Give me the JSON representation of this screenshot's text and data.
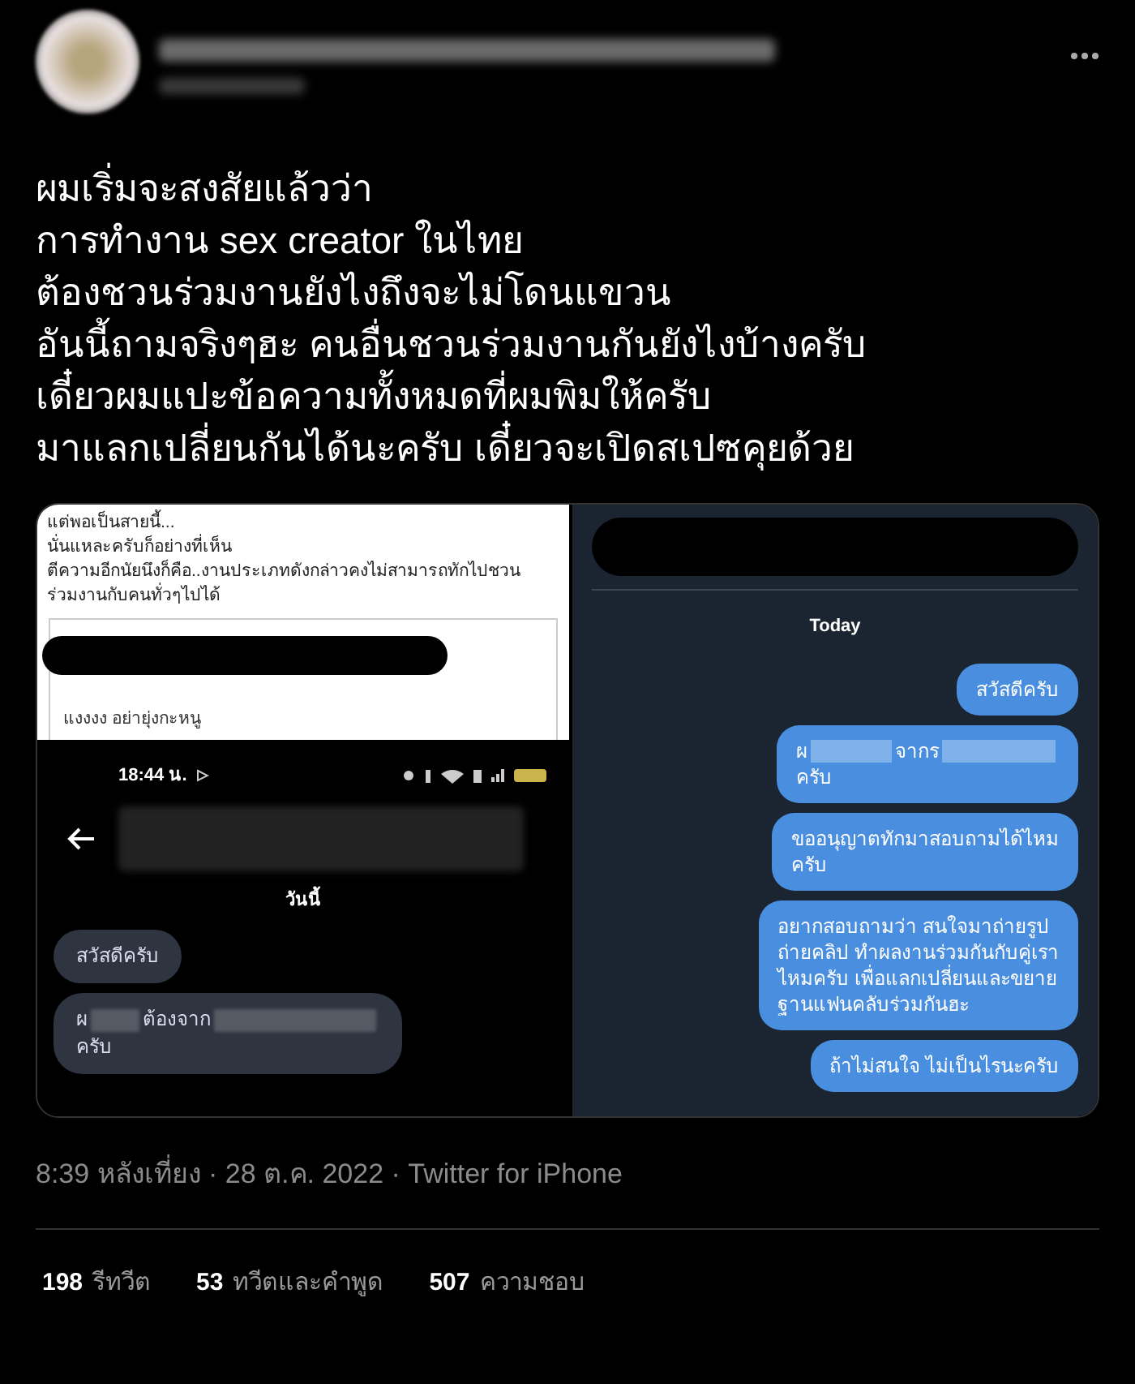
{
  "tweet": {
    "lines": [
      "ผมเริ่มจะสงสัยแล้วว่า",
      "การทำงาน sex creator ในไทย",
      "ต้องชวนร่วมงานยังไงถึงจะไม่โดนแขวน",
      "อันนี้ถามจริงๆฮะ คนอื่นชวนร่วมงานกันยังไงบ้างครับ",
      "เดี๋ยวผมแปะข้อความทั้งหมดที่ผมพิมให้ครับ",
      "มาแลกเปลี่ยนกันได้นะครับ เดี๋ยวจะเปิดสเปซคุยด้วย"
    ]
  },
  "media": {
    "left_top": {
      "lines": [
        "แต่พอเป็นสายนี้...",
        "นั่นแหละครับก็อย่างที่เห็น",
        "ตีความอีกนัยนึงก็คือ..งานประเภทดังกล่าวคงไม่สามารถทักไปชวน",
        "ร่วมงานกับคนทั่วๆไปได้"
      ],
      "quote": "แงงงง อย่ายุ่งกะหนู"
    },
    "left_bottom": {
      "time": "18:44 น.",
      "day": "วันนี้",
      "messages": [
        {
          "lines": [
            [
              {
                "kind": "text",
                "text": "สวัสดีครับ"
              }
            ]
          ]
        },
        {
          "lines": [
            [
              {
                "kind": "text",
                "text": "ผ"
              },
              {
                "kind": "blur"
              },
              {
                "kind": "text",
                "text": "ต้องจาก"
              },
              {
                "kind": "blur"
              }
            ],
            [
              {
                "kind": "text",
                "text": "ครับ"
              }
            ]
          ]
        }
      ]
    },
    "right": {
      "day": "Today",
      "messages": [
        {
          "lines": [
            [
              {
                "kind": "text",
                "text": "สวัสดีครับ"
              }
            ]
          ]
        },
        {
          "lines": [
            [
              {
                "kind": "text",
                "text": "ผ"
              },
              {
                "kind": "blur"
              },
              {
                "kind": "text",
                "text": "จากร"
              },
              {
                "kind": "blur"
              }
            ],
            [
              {
                "kind": "text",
                "text": "ครับ"
              }
            ]
          ]
        },
        {
          "lines": [
            [
              {
                "kind": "text",
                "text": "ขออนุญาตทักมาสอบถามได้ไหม"
              }
            ],
            [
              {
                "kind": "text",
                "text": "ครับ"
              }
            ]
          ]
        },
        {
          "lines": [
            [
              {
                "kind": "text",
                "text": "อยากสอบถามว่า สนใจมาถ่ายรูป"
              }
            ],
            [
              {
                "kind": "text",
                "text": "ถ่ายคลิป ทำผลงานร่วมกันกับคู่เรา"
              }
            ],
            [
              {
                "kind": "text",
                "text": "ไหมครับ เพื่อแลกเปลี่ยนและขยาย"
              }
            ],
            [
              {
                "kind": "text",
                "text": "ฐานแฟนคลับร่วมกันฮะ"
              }
            ]
          ]
        },
        {
          "lines": [
            [
              {
                "kind": "text",
                "text": "ถ้าไม่สนใจ ไม่เป็นไรนะครับ"
              }
            ]
          ]
        }
      ]
    }
  },
  "meta": "8:39 หลังเที่ยง · 28 ต.ค. 2022 · Twitter for iPhone",
  "stats": [
    {
      "count": "198",
      "label": "รีทวีต"
    },
    {
      "count": "53",
      "label": "ทวีตและคำพูด"
    },
    {
      "count": "507",
      "label": "ความชอบ"
    }
  ]
}
